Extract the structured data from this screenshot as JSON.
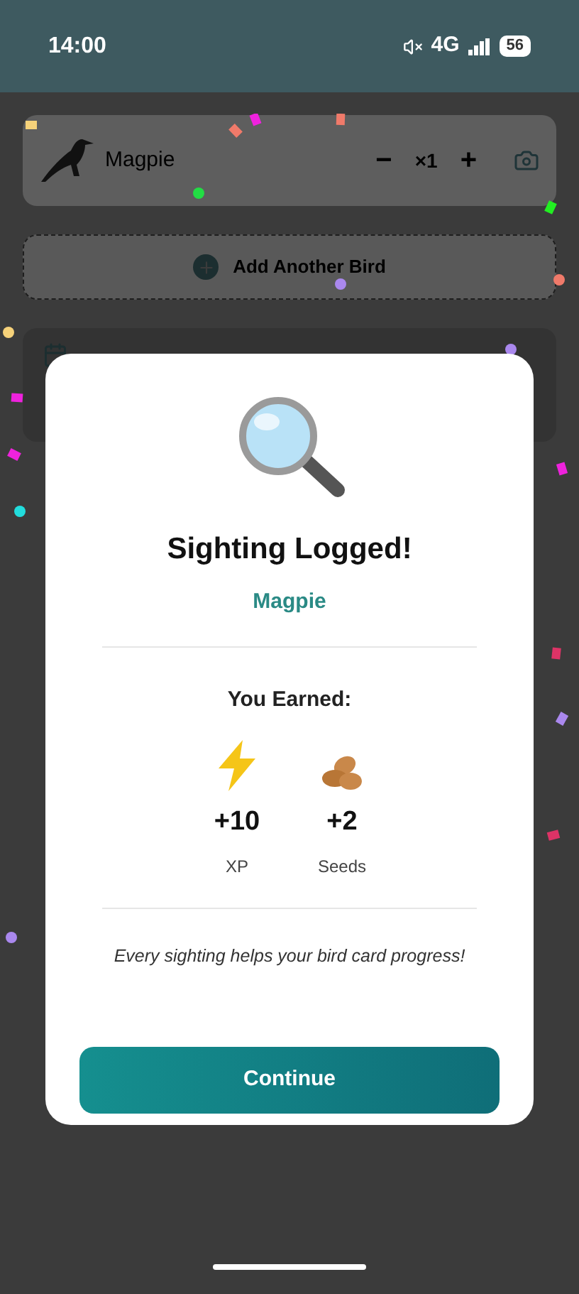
{
  "status_bar": {
    "time": "14:00",
    "network": "4G",
    "battery": "56"
  },
  "bird_row": {
    "name": "Magpie",
    "decrement": "−",
    "count": "×1",
    "increment": "+"
  },
  "add_bird": {
    "label": "Add Another Bird"
  },
  "modal": {
    "title": "Sighting Logged!",
    "bird": "Magpie",
    "earned_heading": "You Earned:",
    "rewards": [
      {
        "kind": "xp",
        "amount": "+10",
        "label": "XP"
      },
      {
        "kind": "seeds",
        "amount": "+2",
        "label": "Seeds"
      }
    ],
    "note": "Every sighting helps your bird card progress!",
    "button": "Continue"
  }
}
